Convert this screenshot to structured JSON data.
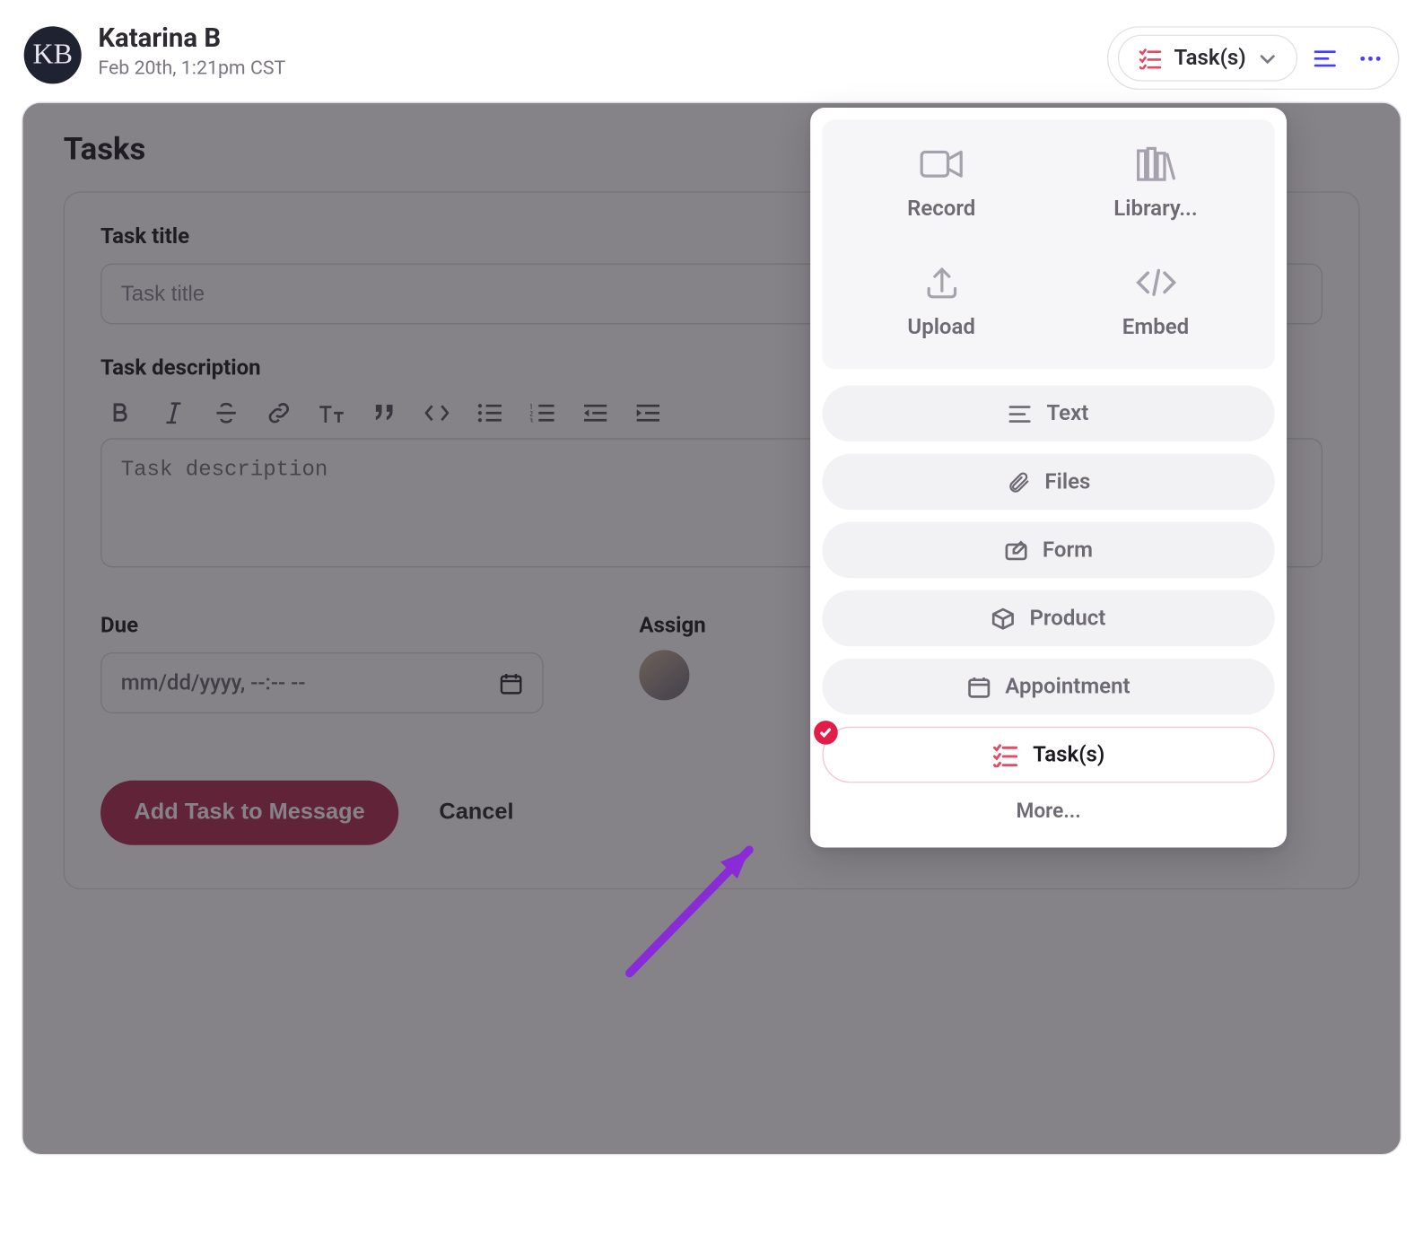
{
  "header": {
    "avatar_initials": "KB",
    "user_name": "Katarina B",
    "timestamp": "Feb 20th, 1:21pm CST",
    "tasks_chip_label": "Task(s)"
  },
  "tasks": {
    "section_title": "Tasks",
    "title_label": "Task title",
    "title_placeholder": "Task title",
    "description_label": "Task description",
    "description_placeholder": "Task description",
    "due_label": "Due",
    "due_placeholder": "mm/dd/yyyy, --:-- --",
    "assign_label": "Assign",
    "add_button": "Add Task to Message",
    "cancel_button": "Cancel"
  },
  "dropdown": {
    "media": {
      "record": "Record",
      "library": "Library...",
      "upload": "Upload",
      "embed": "Embed"
    },
    "options": {
      "text": "Text",
      "files": "Files",
      "form": "Form",
      "product": "Product",
      "appointment": "Appointment",
      "tasks": "Task(s)"
    },
    "more": "More..."
  }
}
